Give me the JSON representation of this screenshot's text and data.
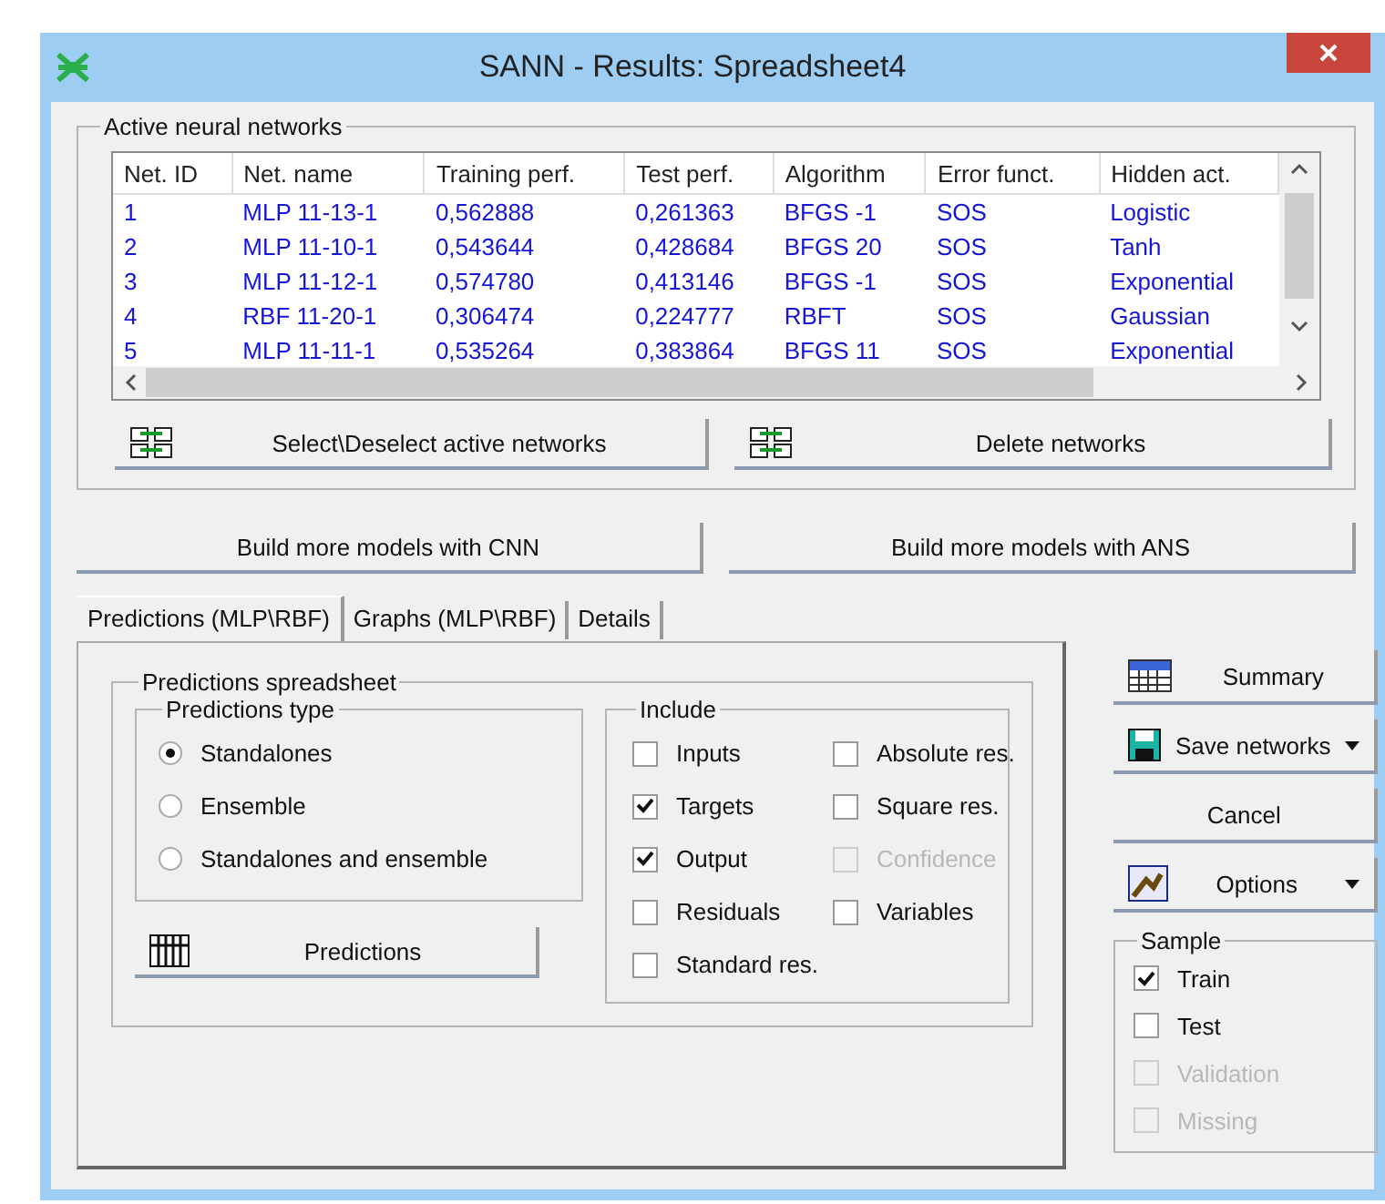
{
  "window": {
    "title": "SANN - Results: Spreadsheet4"
  },
  "networks_group": {
    "label": "Active neural networks",
    "columns": [
      "Net. ID",
      "Net. name",
      "Training perf.",
      "Test perf.",
      "Algorithm",
      "Error funct.",
      "Hidden act."
    ],
    "rows": [
      [
        "1",
        "MLP 11-13-1",
        "0,562888",
        "0,261363",
        "BFGS -1",
        "SOS",
        "Logistic"
      ],
      [
        "2",
        "MLP 11-10-1",
        "0,543644",
        "0,428684",
        "BFGS 20",
        "SOS",
        "Tanh"
      ],
      [
        "3",
        "MLP 11-12-1",
        "0,574780",
        "0,413146",
        "BFGS -1",
        "SOS",
        "Exponential"
      ],
      [
        "4",
        "RBF 11-20-1",
        "0,306474",
        "0,224777",
        "RBFT",
        "SOS",
        "Gaussian"
      ],
      [
        "5",
        "MLP 11-11-1",
        "0,535264",
        "0,383864",
        "BFGS 11",
        "SOS",
        "Exponential"
      ]
    ],
    "buttons": [
      "Select\\Deselect active networks",
      "Delete networks"
    ]
  },
  "build_buttons": [
    "Build more models with CNN",
    "Build more models with ANS"
  ],
  "tabs": [
    {
      "label": "Predictions (MLP\\RBF)",
      "selected": true
    },
    {
      "label": "Graphs (MLP\\RBF)",
      "selected": false
    },
    {
      "label": "Details",
      "selected": false
    }
  ],
  "predictions_spreadsheet": {
    "label": "Predictions spreadsheet",
    "predictions_type": {
      "label": "Predictions type",
      "options": [
        {
          "label": "Standalones",
          "selected": true
        },
        {
          "label": "Ensemble",
          "selected": false
        },
        {
          "label": "Standalones and ensemble",
          "selected": false
        }
      ]
    },
    "predictions_button": "Predictions",
    "include": {
      "label": "Include",
      "items": [
        {
          "label": "Inputs",
          "checked": false,
          "disabled": false
        },
        {
          "label": "Absolute res.",
          "checked": false,
          "disabled": false
        },
        {
          "label": "Targets",
          "checked": true,
          "disabled": false
        },
        {
          "label": "Square res.",
          "checked": false,
          "disabled": false
        },
        {
          "label": "Output",
          "checked": true,
          "disabled": false
        },
        {
          "label": "Confidence",
          "checked": false,
          "disabled": true
        },
        {
          "label": "Residuals",
          "checked": false,
          "disabled": false
        },
        {
          "label": "Variables",
          "checked": false,
          "disabled": false
        },
        {
          "label": "Standard res.",
          "checked": false,
          "disabled": false
        }
      ]
    }
  },
  "side_buttons": [
    {
      "label": "Summary",
      "kind": "summary"
    },
    {
      "label": "Save networks",
      "kind": "save"
    },
    {
      "label": "Cancel",
      "kind": "plain"
    },
    {
      "label": "Options",
      "kind": "options"
    }
  ],
  "sample": {
    "label": "Sample",
    "items": [
      {
        "label": "Train",
        "checked": true,
        "disabled": false
      },
      {
        "label": "Test",
        "checked": false,
        "disabled": false
      },
      {
        "label": "Validation",
        "checked": false,
        "disabled": true
      },
      {
        "label": "Missing",
        "checked": false,
        "disabled": true
      }
    ]
  }
}
